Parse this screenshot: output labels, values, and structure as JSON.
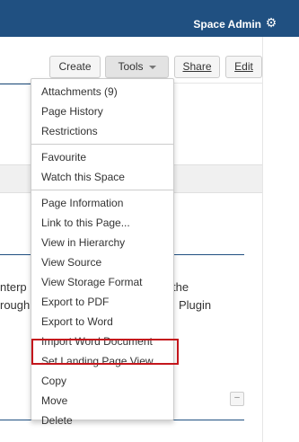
{
  "header": {
    "space_admin_label": "Space Admin",
    "settings_icon": "gear-icon",
    "background_color": "#205081"
  },
  "toolbar": {
    "create_label": "Create",
    "tools_label": "Tools",
    "share_label": "Share",
    "edit_label": "Edit"
  },
  "background_content": {
    "line1a": "nterp",
    "line1b": "the",
    "line2a": "rough",
    "line2b": "Plugin",
    "collapse_button": "–"
  },
  "tools_menu": {
    "groups": [
      {
        "items": [
          "Attachments (9)",
          "Page History",
          "Restrictions"
        ]
      },
      {
        "items": [
          "Favourite",
          "Watch this Space"
        ]
      },
      {
        "items": [
          "Page Information",
          "Link to this Page...",
          "View in Hierarchy",
          "View Source",
          "View Storage Format",
          "Export to PDF",
          "Export to Word",
          "Import Word Document",
          "Set Landing Page View",
          "Copy",
          "Move",
          "Delete"
        ]
      }
    ],
    "highlighted_item": "Set Landing Page View",
    "highlight_color": "#c4161c"
  }
}
